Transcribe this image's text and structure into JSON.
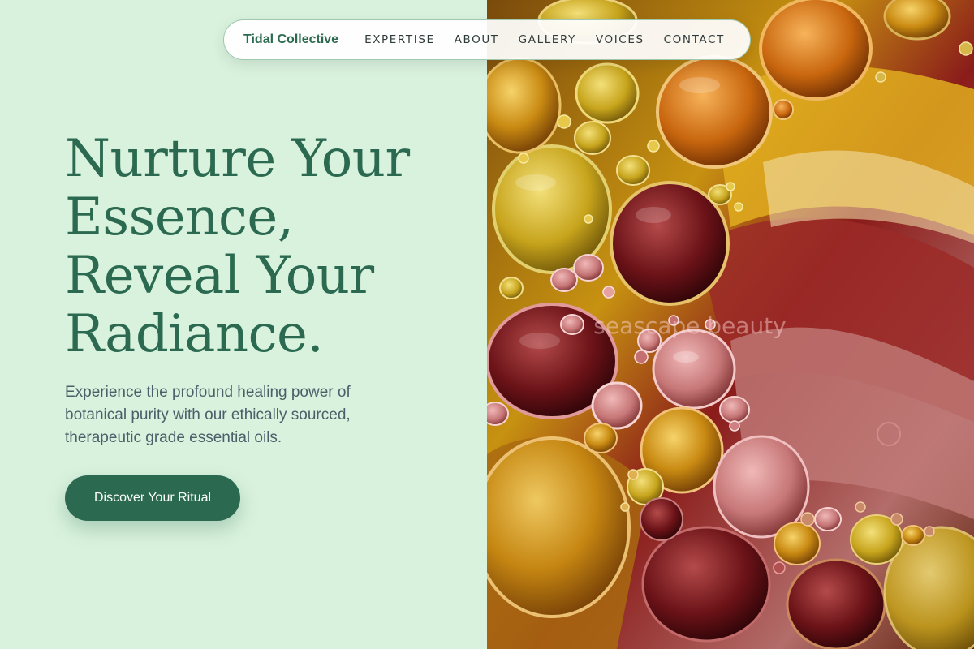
{
  "nav": {
    "brand": "Tidal Collective",
    "links": [
      "EXPERTISE",
      "ABOUT",
      "GALLERY",
      "VOICES",
      "CONTACT"
    ]
  },
  "hero": {
    "title_lines": [
      "Nurture Your",
      "Essence,",
      "Reveal Your",
      "Radiance."
    ],
    "subtitle": "Experience the profound healing power of botanical purity with our ethically sourced, therapeutic grade essential oils.",
    "cta_label": "Discover Your Ritual"
  },
  "image": {
    "watermark": "seascape.beauty"
  },
  "colors": {
    "background": "#d9f2de",
    "brand_green": "#2b6a50",
    "body_text": "#4b5f6a",
    "nav_text": "#2f3b3a"
  }
}
